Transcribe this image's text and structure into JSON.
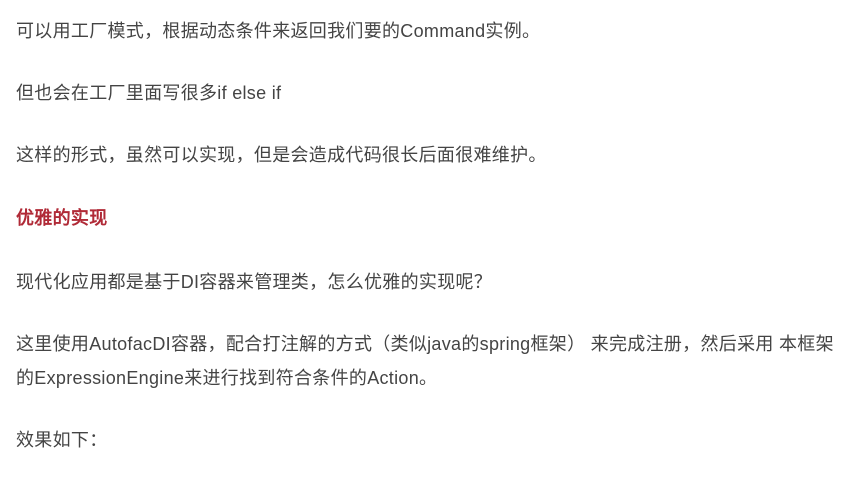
{
  "paragraphs": {
    "p1": "可以用工厂模式，根据动态条件来返回我们要的Command实例。",
    "p2": "但也会在工厂里面写很多if else if",
    "p3": "这样的形式，虽然可以实现，但是会造成代码很长后面很难维护。",
    "heading": "优雅的实现",
    "p4": "现代化应用都是基于DI容器来管理类，怎么优雅的实现呢？",
    "p5": "这里使用AutofacDI容器，配合打注解的方式（类似java的spring框架） 来完成注册，然后采用 本框架的ExpressionEngine来进行找到符合条件的Action。",
    "p6": "效果如下："
  }
}
